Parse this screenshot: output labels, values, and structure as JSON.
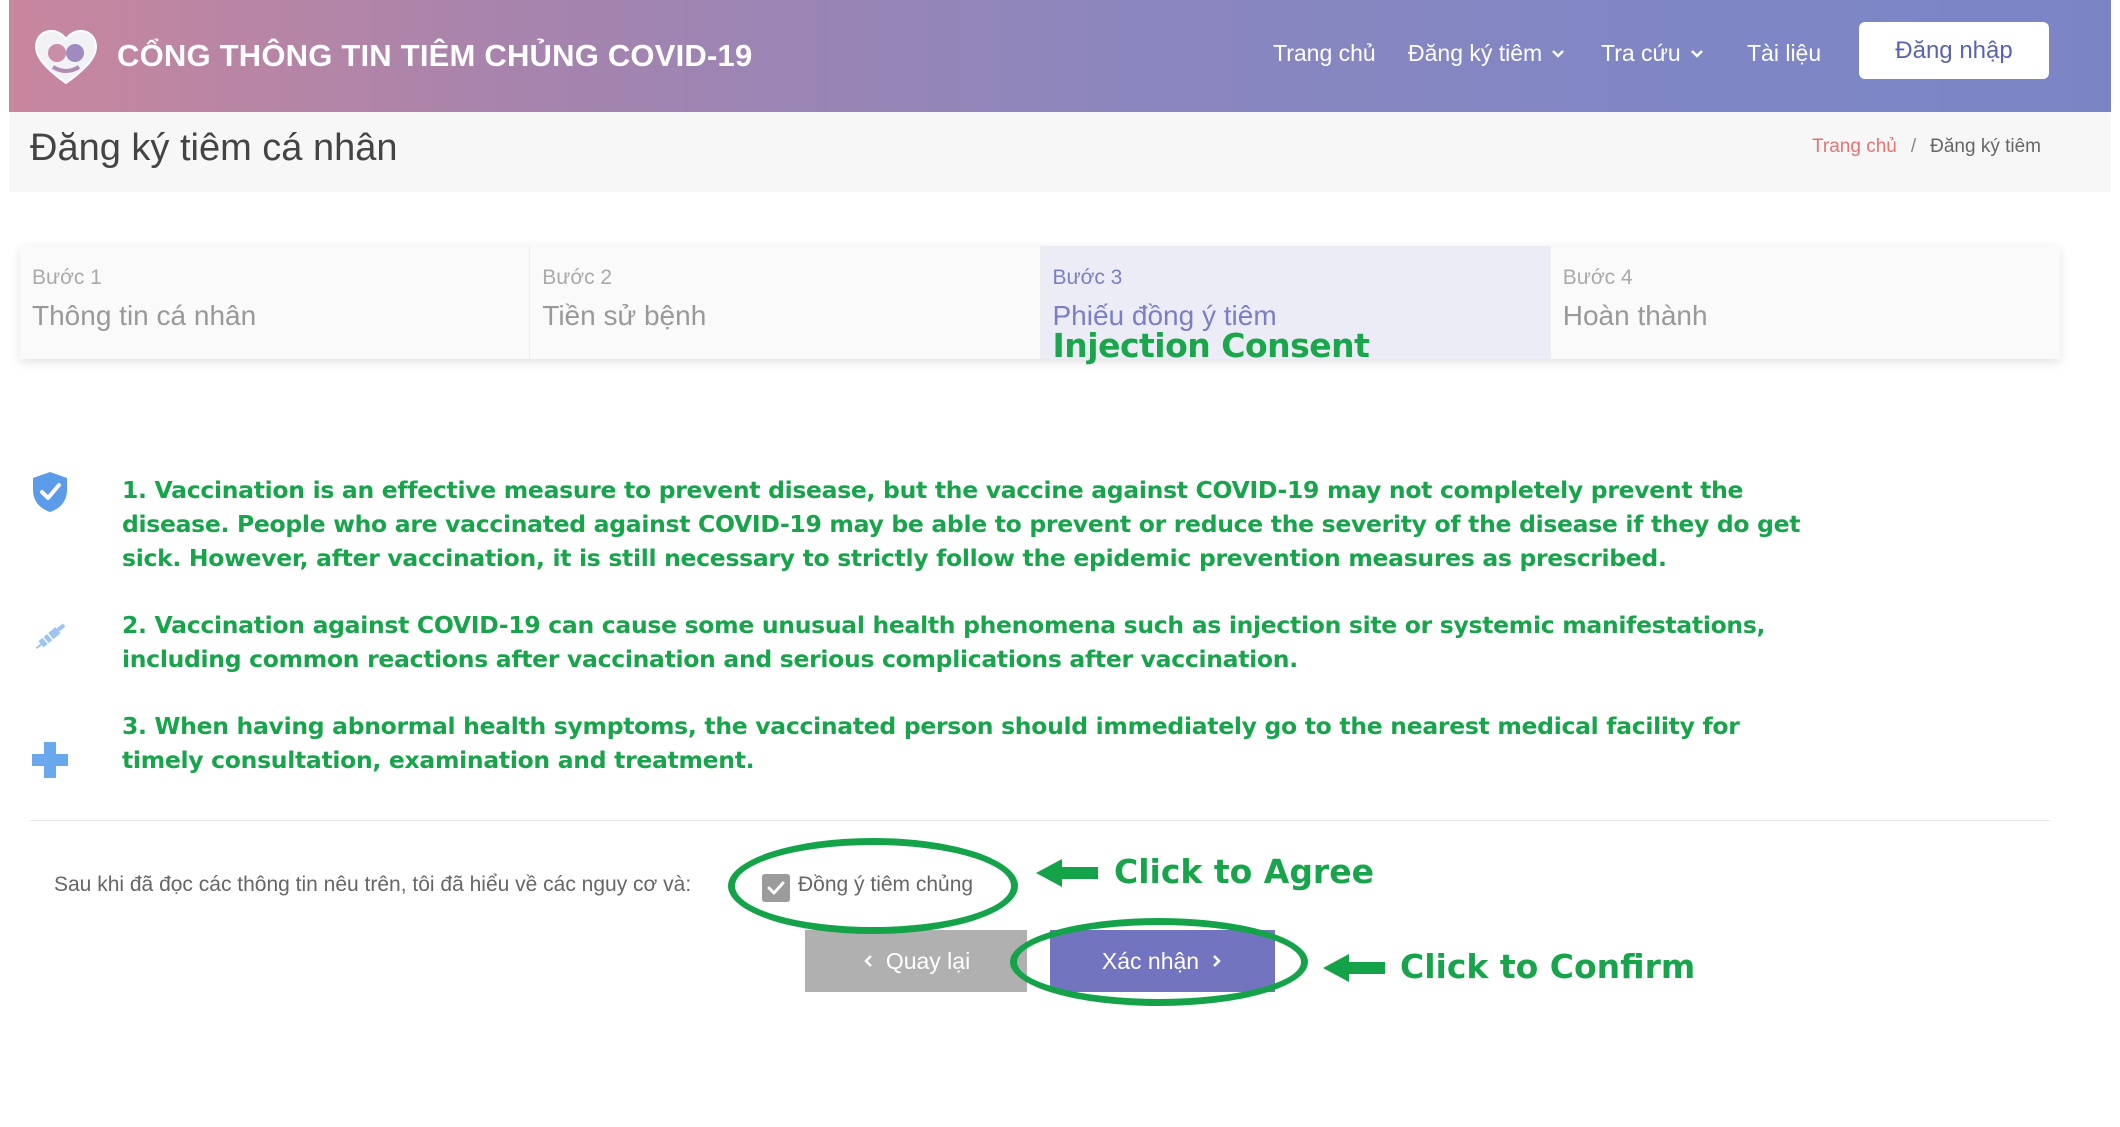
{
  "header": {
    "brand": "CỔNG THÔNG TIN TIÊM CHỦNG COVID-19",
    "nav": {
      "home": "Trang chủ",
      "register": "Đăng ký tiêm",
      "lookup": "Tra cứu",
      "docs": "Tài liệu"
    },
    "login": "Đăng nhập"
  },
  "page": {
    "title": "Đăng ký tiêm cá nhân",
    "breadcrumb": {
      "home": "Trang chủ",
      "separator": "/",
      "current": "Đăng ký tiêm"
    }
  },
  "steps": [
    {
      "num": "Bước 1",
      "label": "Thông tin cá nhân"
    },
    {
      "num": "Bước 2",
      "label": "Tiền sử bệnh"
    },
    {
      "num": "Bước 3",
      "label": "Phiếu đồng ý tiêm",
      "caption": "Injection Consent"
    },
    {
      "num": "Bước 4",
      "label": "Hoàn thành"
    }
  ],
  "notes": [
    "1. Vaccination is an effective measure to prevent disease, but the vaccine against COVID-19 may not completely prevent the disease. People who are vaccinated against COVID-19 may be able to prevent or reduce the severity of the disease if they do get sick. However, after vaccination, it is still necessary to strictly follow the epidemic prevention measures as prescribed.",
    "2. Vaccination against COVID-19 can cause some unusual health phenomena such as injection site or systemic manifestations, including common reactions after vaccination and serious complications after vaccination.",
    "3. When having abnormal health symptoms, the vaccinated person should immediately go to the nearest medical facility for timely consultation, examination and treatment."
  ],
  "agreement": {
    "text": "Sau khi đã đọc các thông tin nêu trên, tôi đã hiểu về các nguy cơ và:",
    "checkbox_label": "Đồng ý tiêm chủng",
    "checked": true
  },
  "buttons": {
    "back": "Quay lại",
    "confirm": "Xác nhận"
  },
  "annotations": {
    "agree": "Click to Agree",
    "confirm": "Click to Confirm"
  },
  "colors": {
    "accent": "#7274bf",
    "annotation_green": "#17a44a",
    "breadcrumb_home": "#e57373"
  }
}
